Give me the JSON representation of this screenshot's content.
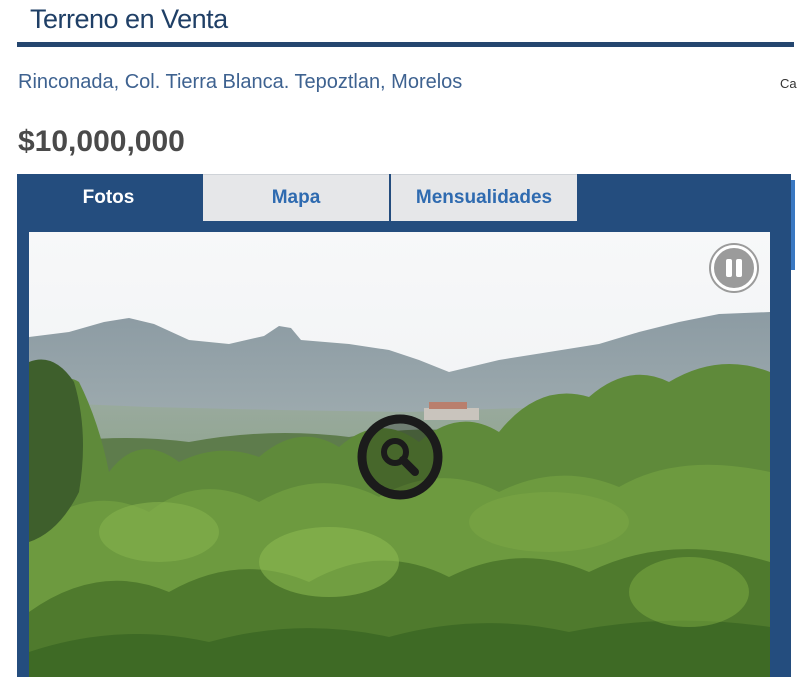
{
  "listing": {
    "title": "Terreno en Venta",
    "address": "Rinconada, Col. Tierra Blanca. Tepoztlan, Morelos",
    "cut_text": "Ca",
    "price": "$10,000,000"
  },
  "tabs": [
    {
      "label": "Fotos",
      "active": true
    },
    {
      "label": "Mapa",
      "active": false
    },
    {
      "label": "Mensualidades",
      "active": false
    }
  ],
  "gallery": {
    "photo": "landscape-photo",
    "controls": [
      "pause-icon",
      "magnifier-icon"
    ]
  },
  "colors": {
    "primary": "#244d7e",
    "title": "#1f3f66",
    "link": "#2f6bb0",
    "price": "#4a4a4a",
    "tab_inactive_bg": "#e6e7e9"
  }
}
